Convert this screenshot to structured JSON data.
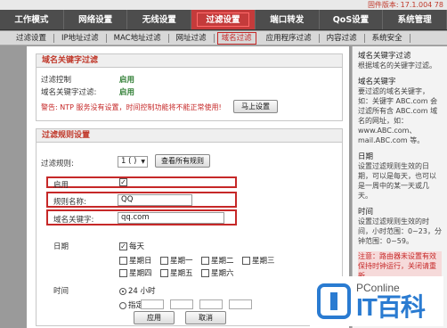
{
  "firmware": {
    "label": "固件版本:",
    "version": "17.1.004 78"
  },
  "top_nav": [
    "工作模式",
    "网络设置",
    "无线设置",
    "过滤设置",
    "端口转发",
    "QoS设置",
    "系统管理"
  ],
  "top_nav_active": 3,
  "sub_nav": [
    "过滤设置",
    "IP地址过滤",
    "MAC地址过滤",
    "网址过滤",
    "域名过滤",
    "应用程序过滤",
    "内容过滤",
    "系统安全"
  ],
  "sub_nav_active": 4,
  "section1": {
    "title": "域名关键字过滤",
    "filter_control_label": "过滤控制",
    "filter_control_value": "启用",
    "keyword_filter_label": "域名关键字过滤:",
    "keyword_filter_value": "启用",
    "warning": "警告: NTP 服务没有设置，时间控制功能将不能正常使用!",
    "setup_button": "马上设置"
  },
  "section2": {
    "title": "过滤规则设置",
    "rule_label": "过滤规则:",
    "rule_select": "1 ( )",
    "view_all_button": "查看所有规则",
    "enable_label": "启用",
    "rule_name_label": "规则名称:",
    "rule_name_value": "QQ",
    "keyword_label": "域名关键字:",
    "keyword_value": "qq.com",
    "date_label": "日期",
    "everyday_label": "每天",
    "weekdays": [
      "星期日",
      "星期一",
      "星期二",
      "星期三",
      "星期四",
      "星期五",
      "星期六"
    ],
    "time_label": "时间",
    "hours24_label": "24 小时",
    "specify_label": "指定:",
    "apply_button": "应用",
    "cancel_button": "取消"
  },
  "sidebar": {
    "blocks": [
      {
        "title": "域名关键字过滤",
        "text": "根据域名的关键字过滤。",
        "red": false
      },
      {
        "title": "域名关键字",
        "text": "要过滤的域名关键字，如：关键字 ABC.com 会过滤所有含 ABC.com 域名的网址，如：www.ABC.com、mail.ABC.com 等。",
        "red": false
      },
      {
        "title": "日期",
        "text": "设置过滤规则生效的日期，可以是每天，也可以是一周中的某一天或几天。",
        "red": false
      },
      {
        "title": "时间",
        "text": "设置过滤规则生效的时间，小时范围：0~23，分钟范围：0~59。",
        "red": false
      },
      {
        "title": "",
        "text": "注意：路由器未设置有效保持时钟运行，关闭请重新",
        "red": true
      }
    ]
  },
  "brand": {
    "pc": "PConline",
    "it": "IT百科"
  }
}
